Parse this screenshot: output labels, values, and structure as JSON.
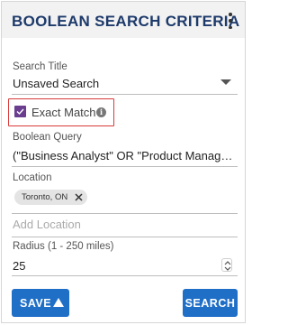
{
  "header": {
    "title": "BOOLEAN SEARCH CRITERIA"
  },
  "search_title": {
    "label": "Search Title",
    "value": "Unsaved Search"
  },
  "exact_match": {
    "label": "Exact Match",
    "checked": true,
    "info_glyph": "i"
  },
  "boolean_query": {
    "label": "Boolean Query",
    "value": "(\"Business Analyst\" OR \"Product Manager) A ..."
  },
  "location": {
    "label": "Location",
    "chips": [
      {
        "label": "Toronto, ON"
      }
    ],
    "add_placeholder": "Add Location"
  },
  "radius": {
    "label": "Radius (1 - 250 miles)",
    "value": "25"
  },
  "buttons": {
    "save": "SAVE",
    "search": "SEARCH"
  },
  "colors": {
    "title": "#1d3a6b",
    "accent_button": "#1f6fc7",
    "checkbox": "#6a3d8f",
    "highlight_border": "#d93a3a"
  }
}
